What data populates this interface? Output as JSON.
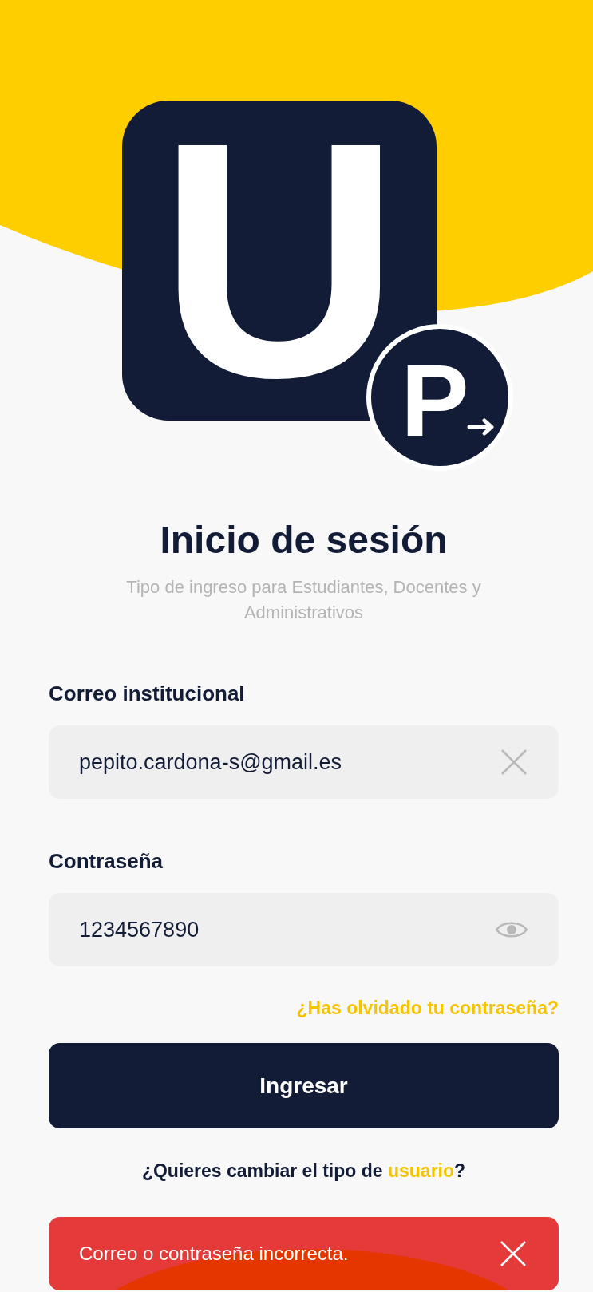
{
  "logo": {
    "main_letter": "U",
    "badge_letter": "P"
  },
  "title": "Inicio de sesión",
  "subtitle": "Tipo de ingreso para Estudiantes, Docentes y Administrativos",
  "fields": [
    {
      "kind": "email",
      "label": "Correo institucional",
      "value": "pepito.cardona-s@gmail.es"
    },
    {
      "kind": "password",
      "label": "Contraseña",
      "value": "1234567890"
    }
  ],
  "forgot_link": "¿Has olvidado tu contraseña?",
  "submit_button": "Ingresar",
  "switch_user": {
    "text": "¿Quieres cambiar el tipo de ",
    "link": "usuario",
    "end": "?"
  },
  "toast": {
    "message": "Correo o contraseña incorrecta."
  }
}
